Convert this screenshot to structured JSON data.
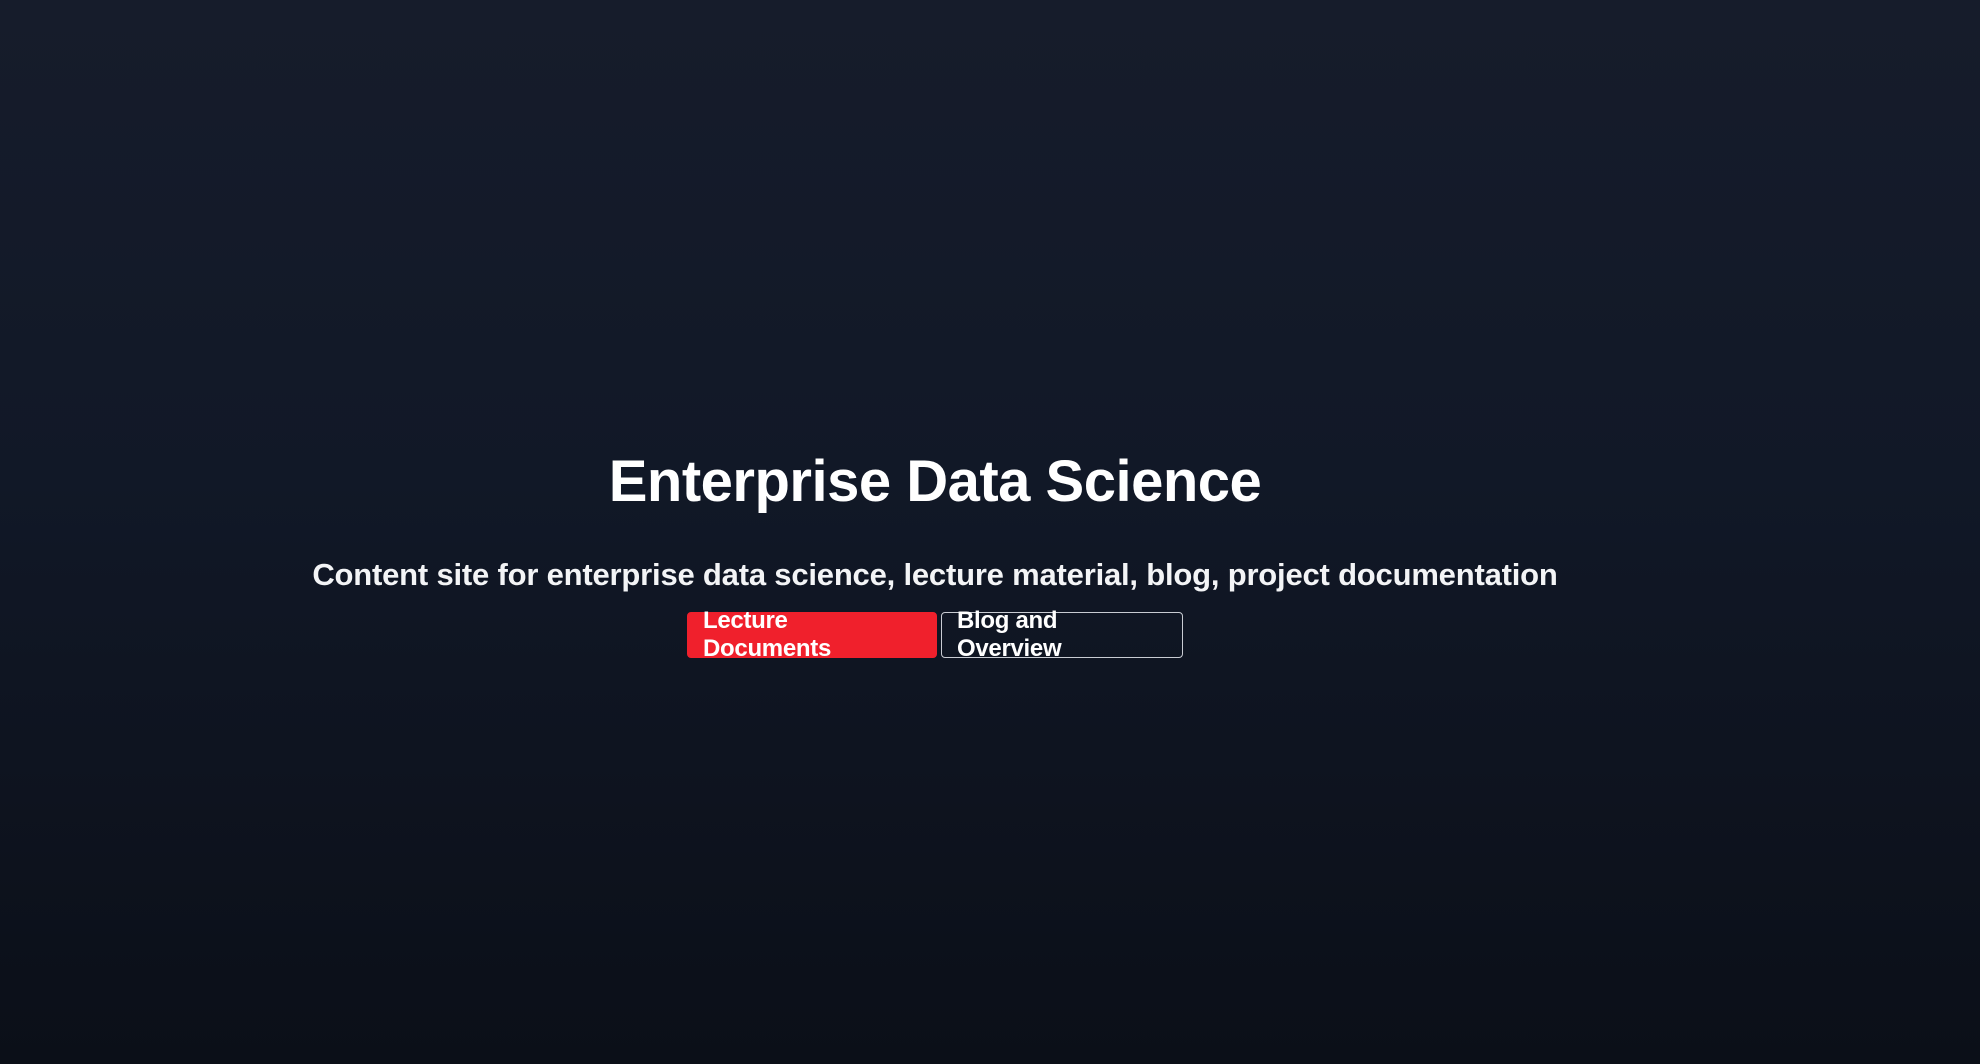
{
  "hero": {
    "title": "Enterprise Data Science",
    "subtitle": "Content site for enterprise data science, lecture material, blog, project documentation",
    "buttons": {
      "primary_label": "Lecture Documents",
      "secondary_label": "Blog and Overview"
    }
  },
  "colors": {
    "background_top": "#161c2b",
    "background_bottom": "#0b0f18",
    "accent": "#f0202c",
    "text": "#ffffff",
    "outline_border": "#c9ccd3"
  }
}
